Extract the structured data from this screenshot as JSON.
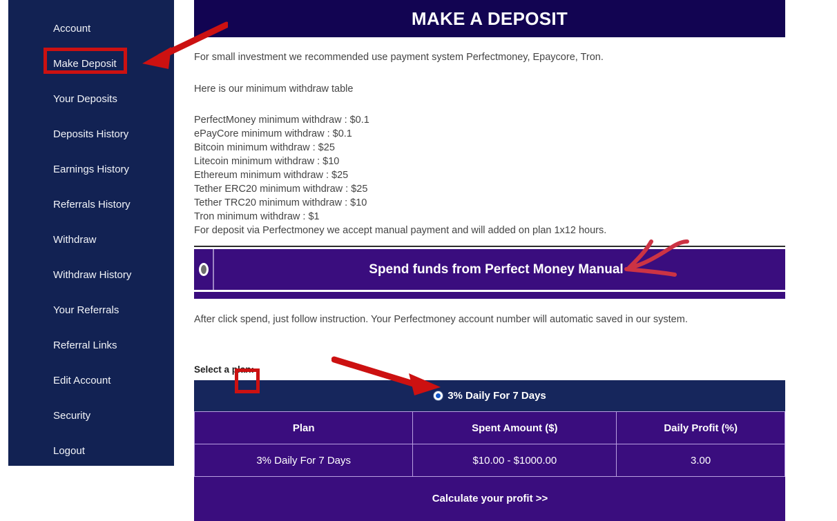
{
  "sidebar": {
    "items": [
      {
        "label": "Account",
        "active": false
      },
      {
        "label": "Make Deposit",
        "active": true
      },
      {
        "label": "Your Deposits",
        "active": false
      },
      {
        "label": "Deposits History",
        "active": false
      },
      {
        "label": "Earnings History",
        "active": false
      },
      {
        "label": "Referrals History",
        "active": false
      },
      {
        "label": "Withdraw",
        "active": false
      },
      {
        "label": "Withdraw History",
        "active": false
      },
      {
        "label": "Your Referrals",
        "active": false
      },
      {
        "label": "Referral Links",
        "active": false
      },
      {
        "label": "Edit Account",
        "active": false
      },
      {
        "label": "Security",
        "active": false
      },
      {
        "label": "Logout",
        "active": false
      }
    ]
  },
  "main": {
    "page_title": "MAKE A DEPOSIT",
    "intro_line": "For small investment we recommended use payment system Perfectmoney, Epaycore, Tron.",
    "table_intro_line": "Here is our minimum withdraw table",
    "withdraw_minimums": [
      "PerfectMoney minimum withdraw : $0.1",
      "ePayCore minimum withdraw : $0.1",
      "Bitcoin minimum withdraw : $25",
      "Litecoin minimum withdraw : $10",
      "Ethereum minimum withdraw : $25",
      "Tether ERC20 minimum withdraw : $25",
      "Tether TRC20 minimum withdraw : $10",
      "Tron minimum withdraw : $1"
    ],
    "manual_note": "For deposit via Perfectmoney we accept manual payment and will added on plan 1x12 hours.",
    "spend_banner_label": "Spend funds from Perfect Money Manual",
    "after_click_note": "After click spend, just follow instruction. Your Perfectmoney account number will automatic saved in our system.",
    "select_plan_label": "Select a plan:",
    "selected_plan_label": "3% Daily For 7 Days",
    "plan_table": {
      "headers": [
        "Plan",
        "Spent Amount ($)",
        "Daily Profit (%)"
      ],
      "rows": [
        [
          "3% Daily For 7 Days",
          "$10.00 - $1000.00",
          "3.00"
        ]
      ]
    },
    "calculate_button_label": "Calculate your profit >>"
  },
  "icons": {
    "perfect_money_logo": "perfect-money-logo-icon",
    "radio_selected": "radio-selected-icon"
  },
  "annotations": {
    "arrow_to_make_deposit": "red-arrow",
    "arrow_to_spend_banner": "red-arrow-handdrawn",
    "arrow_to_plan_radio": "red-arrow",
    "highlight_make_deposit": "red-box",
    "highlight_plan_radio": "red-box"
  },
  "colors": {
    "sidebar_bg": "#122253",
    "banner_navy": "#120452",
    "purple": "#3a0d7e",
    "plan_row_navy": "#16265c",
    "annotation_red": "#cc1111",
    "radio_blue": "#1256c8"
  }
}
